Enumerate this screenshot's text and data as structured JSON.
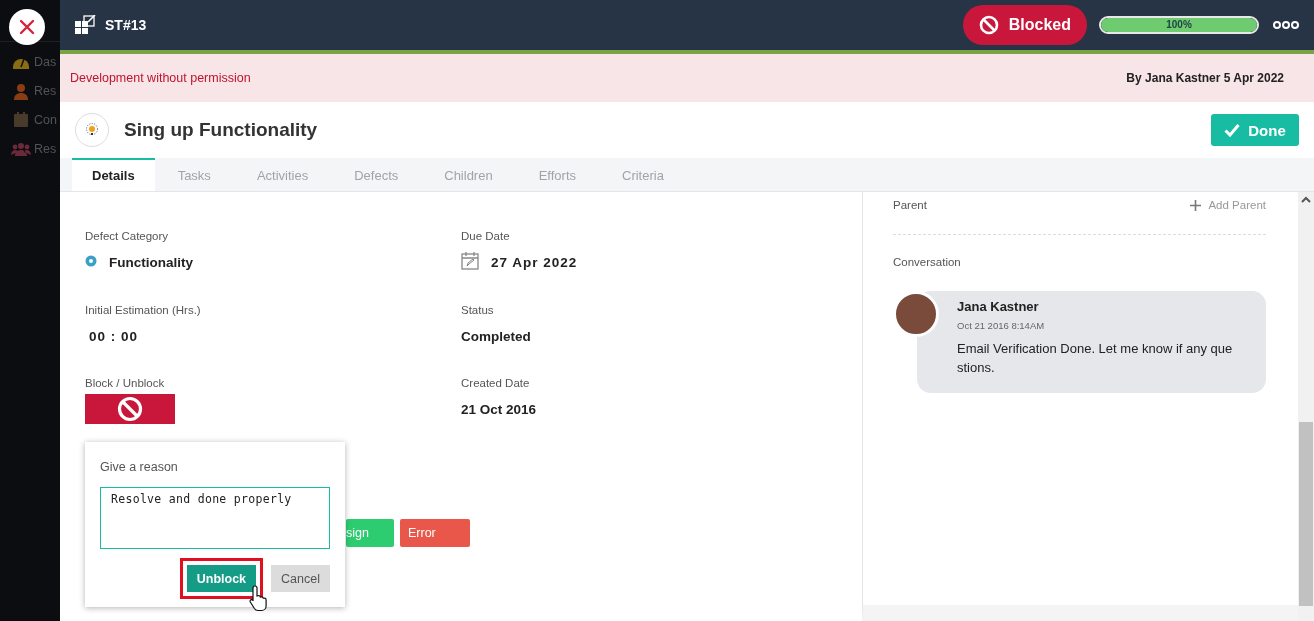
{
  "sidebar": {
    "items": [
      {
        "label": "Das",
        "kind": "dashboard"
      },
      {
        "label": "Res",
        "kind": "person"
      },
      {
        "label": "Con",
        "kind": "calendar"
      },
      {
        "label": "Res",
        "kind": "group"
      }
    ]
  },
  "header": {
    "id": "ST#13",
    "status": "Blocked",
    "progress": {
      "level": 1,
      "reading": "100%"
    }
  },
  "banner": {
    "reason": "Development without permission",
    "byline": "By Jana Kastner 5 Apr 2022"
  },
  "task": {
    "title": "Sing up Functionality",
    "done_button": "Done"
  },
  "tabs": [
    {
      "label": "Details",
      "selected": true
    },
    {
      "label": "Tasks",
      "selected": false
    },
    {
      "label": "Activities",
      "selected": false
    },
    {
      "label": "Defects",
      "selected": false
    },
    {
      "label": "Children",
      "selected": false
    },
    {
      "label": "Efforts",
      "selected": false
    },
    {
      "label": "Criteria",
      "selected": false
    }
  ],
  "fields": [
    {
      "label": "Defect Category",
      "value": "Functionality",
      "kind": "category"
    },
    {
      "label": "Due Date",
      "value": "27 Apr 2022",
      "kind": "date"
    },
    {
      "label": "Initial Estimation (Hrs.)",
      "value": "00 : 00",
      "kind": "time"
    },
    {
      "label": "Status",
      "value": "Completed",
      "kind": "text"
    },
    {
      "label": "Block / Unblock",
      "kind": "block",
      "blocked": true
    },
    {
      "label": "Created Date",
      "value": "21 Oct 2016",
      "kind": "text"
    }
  ],
  "action_buttons": [
    {
      "label": "sign",
      "kind": "success"
    },
    {
      "label": "Error",
      "kind": "danger"
    }
  ],
  "reason_popup": {
    "title": "Give a reason",
    "value": "Resolve and done properly",
    "buttons": [
      {
        "label": "Unblock",
        "kind": "primary",
        "highlighted": true
      },
      {
        "label": "Cancel",
        "kind": "secondary",
        "highlighted": false
      }
    ]
  },
  "side_panel": {
    "parent_label": "Parent",
    "add_parent": "Add Parent",
    "conversation_label": "Conversation",
    "messages": [
      {
        "author": "Jana Kastner",
        "time": "Oct 21 2016 8:14AM",
        "text": "Email Verification Done. Let me know if any questions."
      }
    ]
  }
}
